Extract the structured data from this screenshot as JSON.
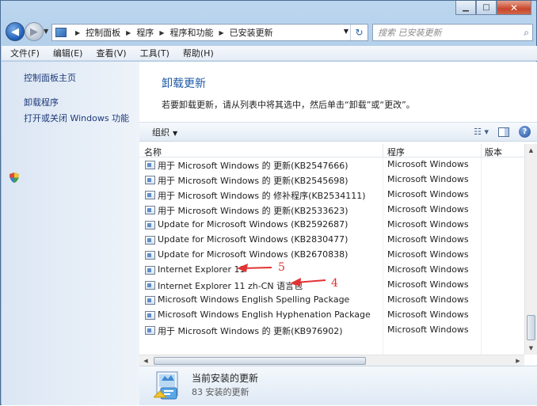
{
  "window": {
    "caption_buttons": [
      "minimize",
      "maximize",
      "close"
    ]
  },
  "address_bar": {
    "crumbs": [
      "控制面板",
      "程序",
      "程序和功能",
      "已安装更新"
    ]
  },
  "search": {
    "placeholder": "搜索 已安装更新"
  },
  "menu": [
    "文件(F)",
    "编辑(E)",
    "查看(V)",
    "工具(T)",
    "帮助(H)"
  ],
  "left_pane": {
    "links": [
      "控制面板主页",
      "卸载程序",
      "打开或关闭 Windows 功能"
    ]
  },
  "main": {
    "title": "卸载更新",
    "description": "若要卸载更新，请从列表中将其选中，然后单击“卸载”或“更改”。",
    "toolbar": {
      "organize": "组织"
    },
    "columns": [
      "名称",
      "程序",
      "版本"
    ],
    "rows": [
      {
        "name": "用于 Microsoft Windows 的 更新(KB2547666)",
        "program": "Microsoft Windows"
      },
      {
        "name": "用于 Microsoft Windows 的 更新(KB2545698)",
        "program": "Microsoft Windows"
      },
      {
        "name": "用于 Microsoft Windows 的 修补程序(KB2534111)",
        "program": "Microsoft Windows"
      },
      {
        "name": "用于 Microsoft Windows 的 更新(KB2533623)",
        "program": "Microsoft Windows"
      },
      {
        "name": "Update for Microsoft Windows (KB2592687)",
        "program": "Microsoft Windows"
      },
      {
        "name": "Update for Microsoft Windows (KB2830477)",
        "program": "Microsoft Windows"
      },
      {
        "name": "Update for Microsoft Windows (KB2670838)",
        "program": "Microsoft Windows"
      },
      {
        "name": "Internet Explorer 11",
        "program": "Microsoft Windows"
      },
      {
        "name": "Internet Explorer 11 zh-CN 语言包",
        "program": "Microsoft Windows"
      },
      {
        "name": "Microsoft Windows English Spelling Package",
        "program": "Microsoft Windows"
      },
      {
        "name": "Microsoft Windows English Hyphenation Package",
        "program": "Microsoft Windows"
      },
      {
        "name": "用于 Microsoft Windows 的 更新(KB976902)",
        "program": "Microsoft Windows"
      }
    ]
  },
  "details": {
    "title": "当前安装的更新",
    "count": "83 安装的更新"
  },
  "annotations": [
    {
      "label": "5",
      "color": "#e23232"
    },
    {
      "label": "4",
      "color": "#e23232"
    }
  ]
}
